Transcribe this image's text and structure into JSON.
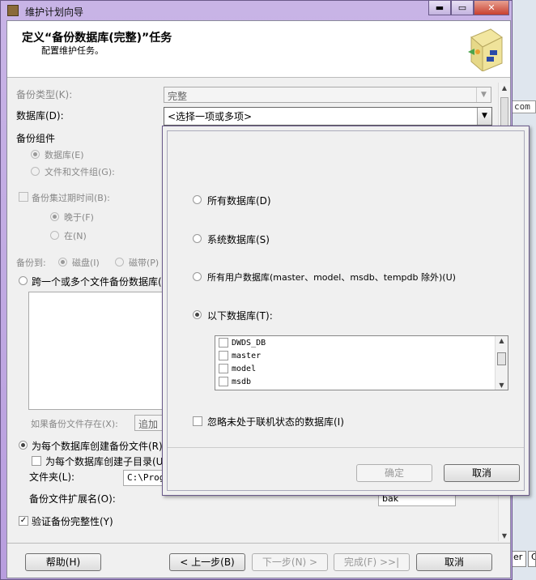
{
  "window": {
    "title": "维护计划向导",
    "minimize": "▬",
    "maximize": "▭",
    "close": "✕"
  },
  "header": {
    "title": "定义“备份数据库(完整)”任务",
    "subtitle": "配置维护任务。"
  },
  "form": {
    "backup_type_label": "备份类型(K):",
    "backup_type_value": "完整",
    "database_label": "数据库(D):",
    "database_value": "<选择一项或多项>",
    "backup_component_label": "备份组件",
    "component_database": "数据库(E)",
    "component_files": "文件和文件组(G):",
    "backup_set_expires": "备份集过期时间(B):",
    "expires_after": "晚于(F)",
    "expires_on": "在(N)",
    "backup_to_label": "备份到:",
    "backup_to_disk": "磁盘(I)",
    "backup_to_tape": "磁带(P)",
    "span_files": "跨一个或多个文件备份数据库(",
    "if_exists_label": "如果备份文件存在(X):",
    "if_exists_value": "追加",
    "create_per_db": "为每个数据库创建备份文件(R)",
    "create_subdir": "为每个数据库创建子目录(U",
    "folder_label": "文件夹(L):",
    "folder_value": "C:\\Progr",
    "extension_label": "备份文件扩展名(O):",
    "extension_value": "bak",
    "verify_integrity": "验证备份完整性(Y)"
  },
  "popup": {
    "all_databases": "所有数据库(D)",
    "system_databases": "系统数据库(S)",
    "user_databases": "所有用户数据库(master、model、msdb、tempdb 除外)(U)",
    "these_databases": "以下数据库(T):",
    "db_items": [
      "DWDS_DB",
      "master",
      "model",
      "msdb"
    ],
    "ignore_offline": "忽略未处于联机状态的数据库(I)",
    "ok": "确定",
    "cancel": "取消"
  },
  "footer": {
    "help": "帮助(H)",
    "back": "< 上一步(B)",
    "next": "下一步(N) >",
    "finish": "完成(F) >>|",
    "cancel": "取消"
  },
  "background": {
    "code_snippet": "com",
    "tab1": "er",
    "tab2": "C"
  },
  "colors": {
    "title_bar": "#c8b4e6",
    "client": "#f0f0f0",
    "accent_green": "#4ca44c",
    "accent_blue": "#2a4aa8"
  }
}
